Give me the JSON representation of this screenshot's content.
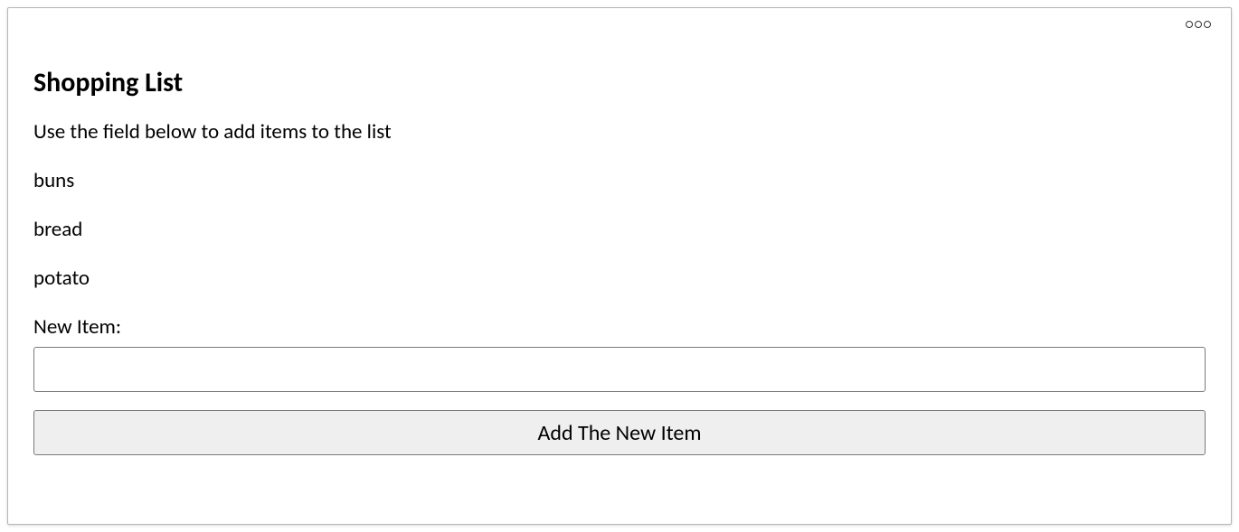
{
  "title": "Shopping List",
  "subheading": "Use the field below to add items to the list",
  "items": [
    "buns",
    "bread",
    "potato"
  ],
  "form": {
    "label": "New Item:",
    "input_value": "",
    "button_label": "Add The New Item"
  }
}
